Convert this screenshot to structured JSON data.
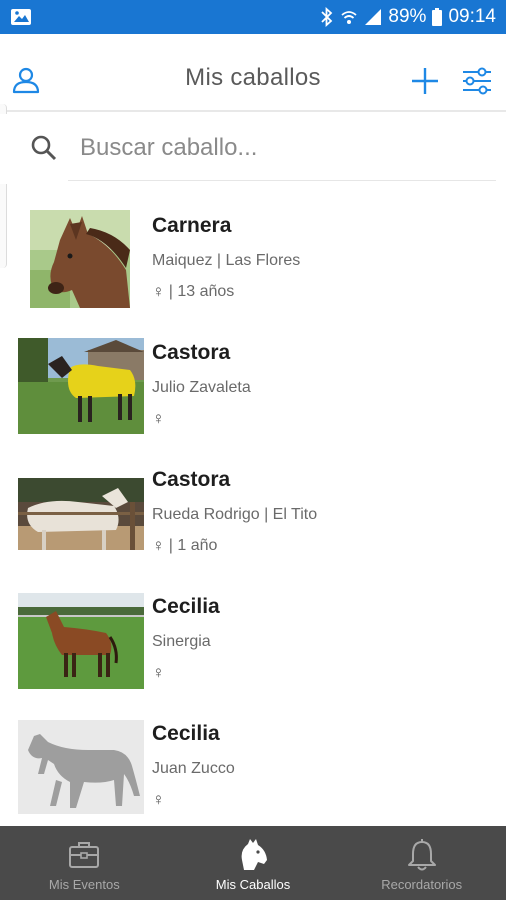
{
  "status_bar": {
    "battery": "89%",
    "time": "09:14"
  },
  "header": {
    "title": "Mis caballos"
  },
  "search": {
    "placeholder": "Buscar caballo..."
  },
  "horses": [
    {
      "name": "Carnera",
      "owner": "Maiquez | Las Flores",
      "sex_symbol": "♀",
      "age": "| 13 años",
      "photo": "brown-horse-head"
    },
    {
      "name": "Castora",
      "owner": "Julio Zavaleta",
      "sex_symbol": "♀",
      "age": "",
      "photo": "horse-yellow-blanket"
    },
    {
      "name": "Castora",
      "owner": "Rueda Rodrigo | El Tito",
      "sex_symbol": "♀",
      "age": "| 1 año",
      "photo": "white-horses-corral"
    },
    {
      "name": "Cecilia",
      "owner": "Sinergia",
      "sex_symbol": "♀",
      "age": "",
      "photo": "bay-horse-field"
    },
    {
      "name": "Cecilia",
      "owner": "Juan Zucco",
      "sex_symbol": "♀",
      "age": "",
      "photo": "horse-silhouette-placeholder"
    }
  ],
  "bottom_nav": {
    "items": [
      {
        "label": "Mis Eventos",
        "icon": "briefcase-icon"
      },
      {
        "label": "Mis Caballos",
        "icon": "horse-head-icon"
      },
      {
        "label": "Recordatorios",
        "icon": "bell-icon"
      }
    ],
    "active": "Mis Caballos"
  },
  "colors": {
    "status_bar": "#1976d2",
    "accent": "#1e88e5",
    "bottom_nav_bg": "#4a4a4a",
    "nav_active": "#ffffff",
    "nav_inactive": "#a8a8a8"
  }
}
